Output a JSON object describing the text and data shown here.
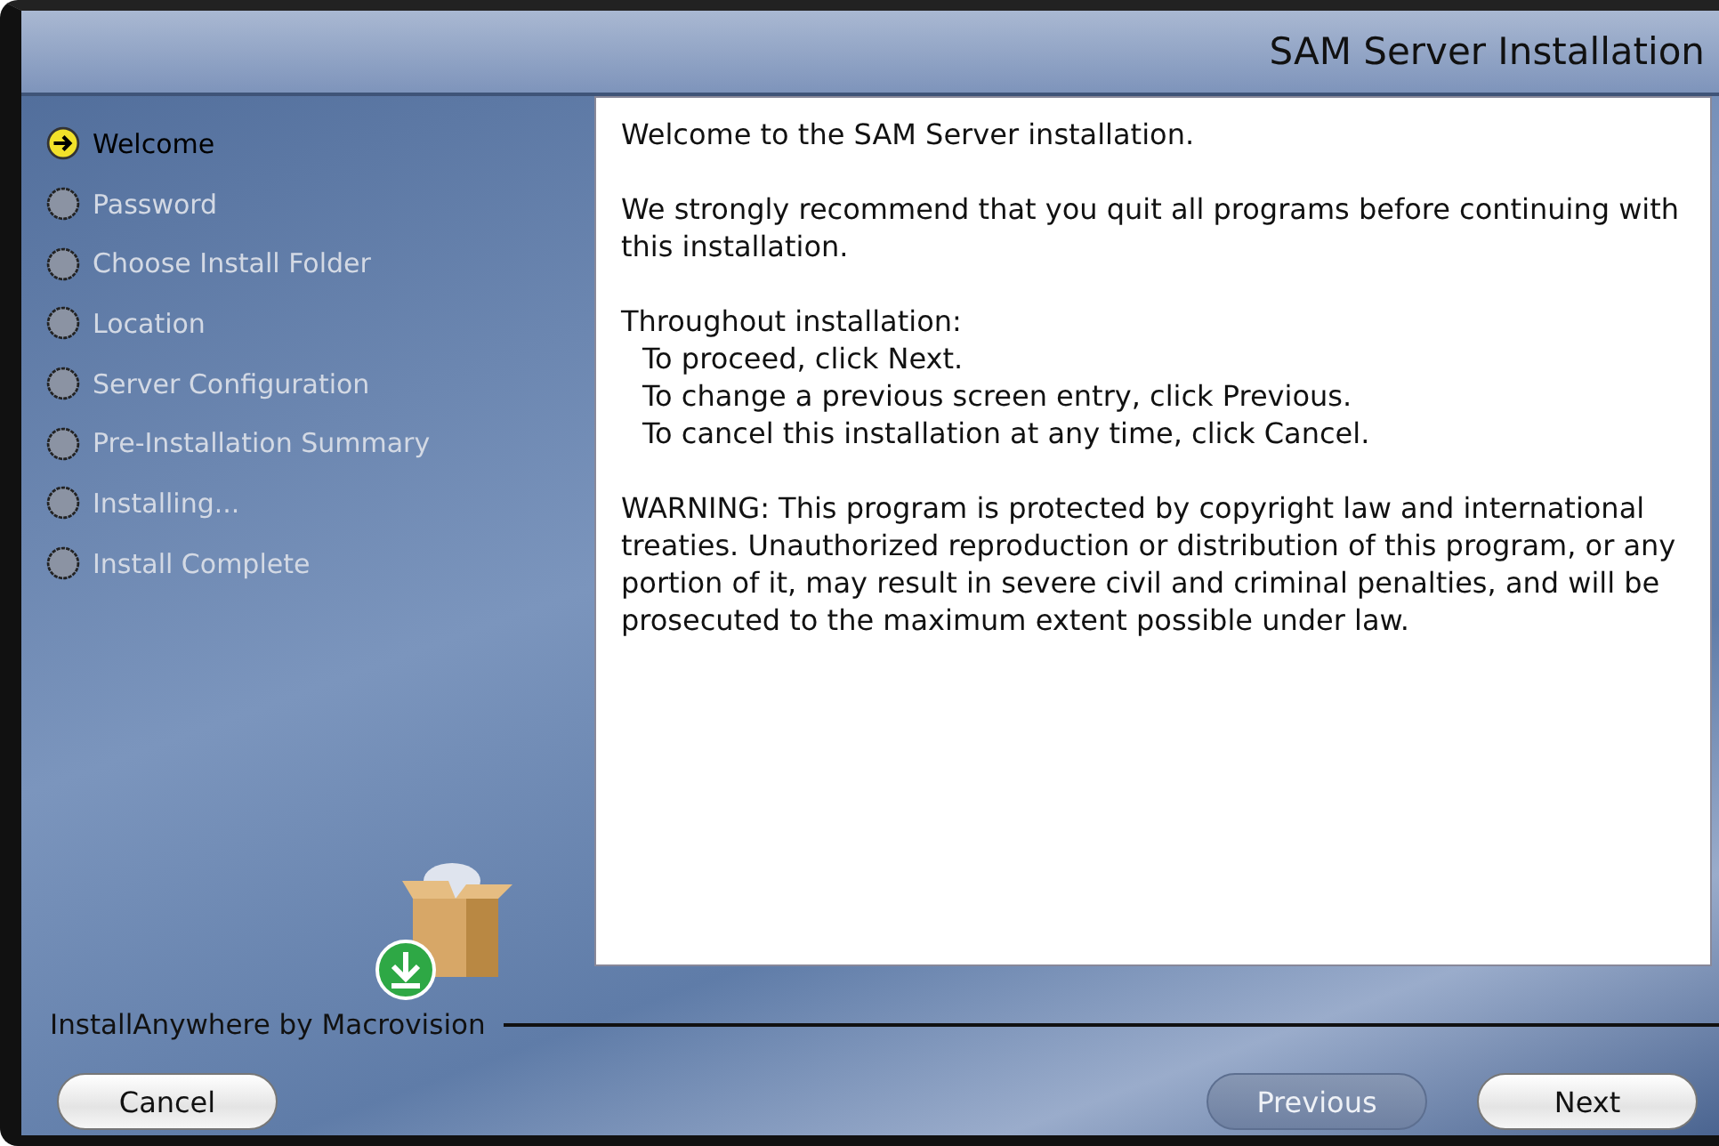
{
  "window": {
    "title": "SAM Server Installation"
  },
  "steps": [
    {
      "label": "Welcome",
      "selected": true
    },
    {
      "label": "Password",
      "selected": false
    },
    {
      "label": "Choose Install Folder",
      "selected": false
    },
    {
      "label": "Location",
      "selected": false
    },
    {
      "label": "Server Configuration",
      "selected": false
    },
    {
      "label": "Pre-Installation Summary",
      "selected": false
    },
    {
      "label": "Installing...",
      "selected": false
    },
    {
      "label": "Install Complete",
      "selected": false
    }
  ],
  "content": [
    {
      "kind": "text",
      "text": "Welcome to the SAM Server installation."
    },
    {
      "kind": "text",
      "text": "We strongly recommend that you quit all programs before continuing with this installation."
    },
    {
      "kind": "list",
      "text": "Throughout installation:",
      "items": [
        "To proceed, click Next.",
        "To change a previous screen entry, click Previous.",
        "To cancel this installation at any time, click Cancel."
      ]
    },
    {
      "kind": "text",
      "text": "WARNING: This program is protected by copyright law and international treaties.  Unauthorized reproduction or distribution of this program, or any portion of it, may result in severe civil and criminal penalties, and will be prosecuted to the maximum extent possible under law."
    }
  ],
  "footer": {
    "brand": "InstallAnywhere by Macrovision"
  },
  "buttons": [
    {
      "label": "Cancel",
      "disabled": false
    },
    {
      "label": "Previous",
      "disabled": true
    },
    {
      "label": "Next",
      "disabled": false
    }
  ]
}
